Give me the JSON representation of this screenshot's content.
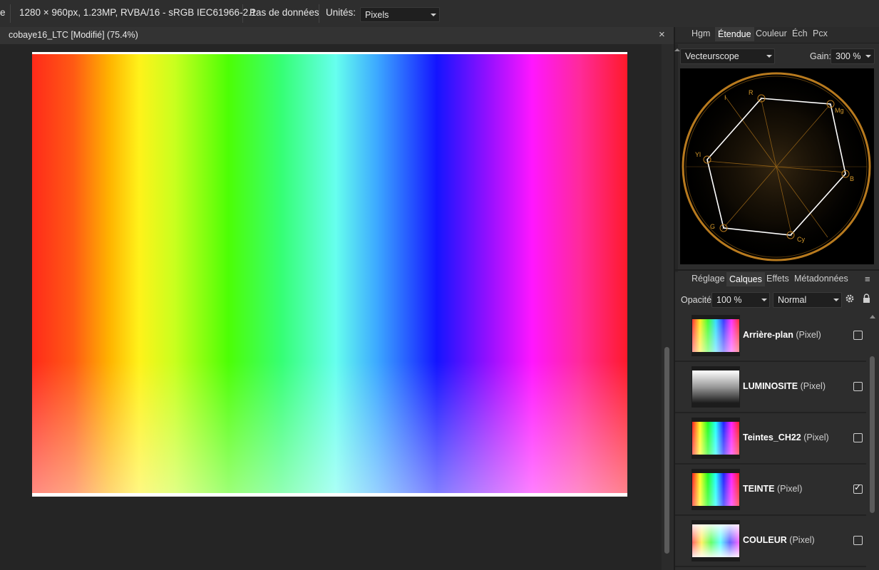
{
  "topbar": {
    "frag": "e",
    "doc_info": "1280 × 960px, 1.23MP, RVBA/16 - sRGB IEC61966-2.1",
    "metadata": "Pas de données",
    "units_label": "Unités:",
    "units_value": "Pixels"
  },
  "document": {
    "tab_title": "cobaye16_LTC [Modifié] (75.4%)",
    "close": "×"
  },
  "scope_panel": {
    "tabs": [
      "Hgm",
      "Étendue",
      "Couleur",
      "Éch",
      "Pcx"
    ],
    "active_tab": "Étendue",
    "mode": "Vecteurscope",
    "gain_label": "Gain:",
    "gain_value": "300 %",
    "targets": [
      "R",
      "Mg",
      "B",
      "Cy",
      "G",
      "Yl",
      "I"
    ]
  },
  "layers_panel": {
    "tabs": [
      "Réglage",
      "Calques",
      "Effets",
      "Métadonnées"
    ],
    "active_tab": "Calques",
    "menu_icon": "≡",
    "opacity_label": "Opacité:",
    "opacity_value": "100 %",
    "blend_mode": "Normal",
    "layers": [
      {
        "name": "Arrière-plan",
        "type": "(Pixel)",
        "checked": false
      },
      {
        "name": "LUMINOSITE",
        "type": "(Pixel)",
        "checked": false
      },
      {
        "name": "Teintes_CH22",
        "type": "(Pixel)",
        "checked": false
      },
      {
        "name": "TEINTE",
        "type": "(Pixel)",
        "checked": true
      },
      {
        "name": "COULEUR",
        "type": "(Pixel)",
        "checked": false
      }
    ]
  },
  "colors": {
    "scope_gold": "#b87a1e",
    "panel_bg": "#2d2d2d"
  }
}
